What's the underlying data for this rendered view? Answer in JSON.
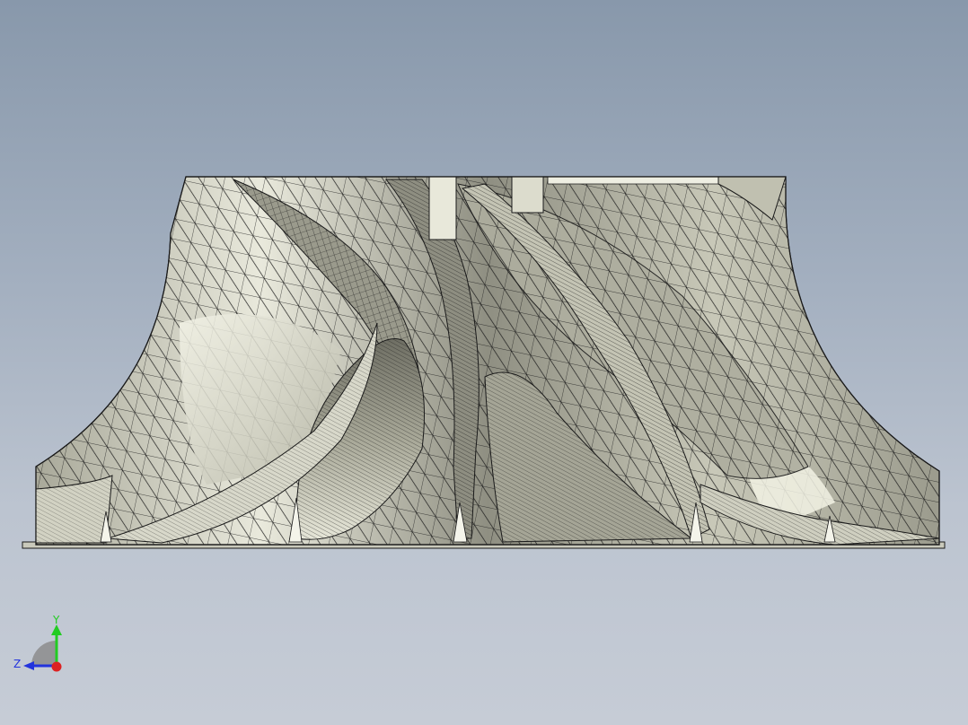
{
  "viewport": {
    "background_top": "#8898ab",
    "background_bottom": "#c6ccd6",
    "model_color": "#d4d4c4",
    "mesh_color": "#1a1a1a"
  },
  "triad": {
    "y_label": "Y",
    "z_label": "Z",
    "y_color": "#22cc22",
    "z_color": "#2233dd",
    "x_color": "#dd2222"
  }
}
